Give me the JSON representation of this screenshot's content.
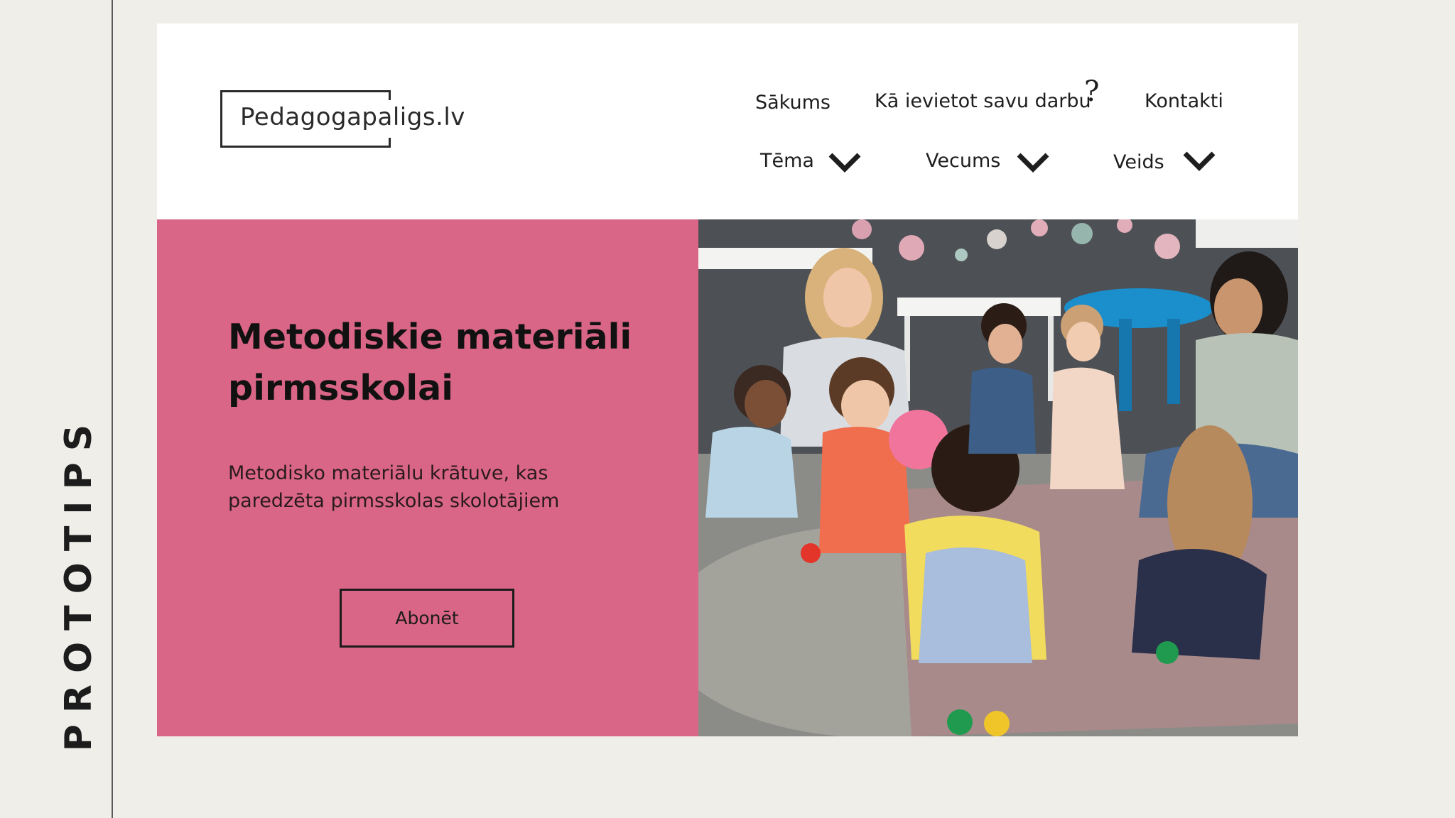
{
  "side_label": "PROTOTIPS",
  "logo": {
    "text": "Pedagogapaligs.lv"
  },
  "nav": {
    "home": "Sākums",
    "how_to": "Kā ievietot savu darbu",
    "question_mark": "?",
    "contacts": "Kontakti",
    "filters": [
      {
        "label": "Tēma",
        "icon": "chevron-down-icon"
      },
      {
        "label": "Vecums",
        "icon": "chevron-down-icon"
      },
      {
        "label": "Veids",
        "icon": "chevron-down-icon"
      }
    ]
  },
  "hero": {
    "title": "Metodiskie materiāli pirmsskolai",
    "subtitle": "Metodisko materiālu krātuve, kas paredzēta pirmsskolas skolotājiem",
    "button": "Abonēt"
  },
  "colors": {
    "background": "#efeee9",
    "hero_panel": "#d96686",
    "frame": "#ffffff",
    "text": "#1e1e1e"
  }
}
